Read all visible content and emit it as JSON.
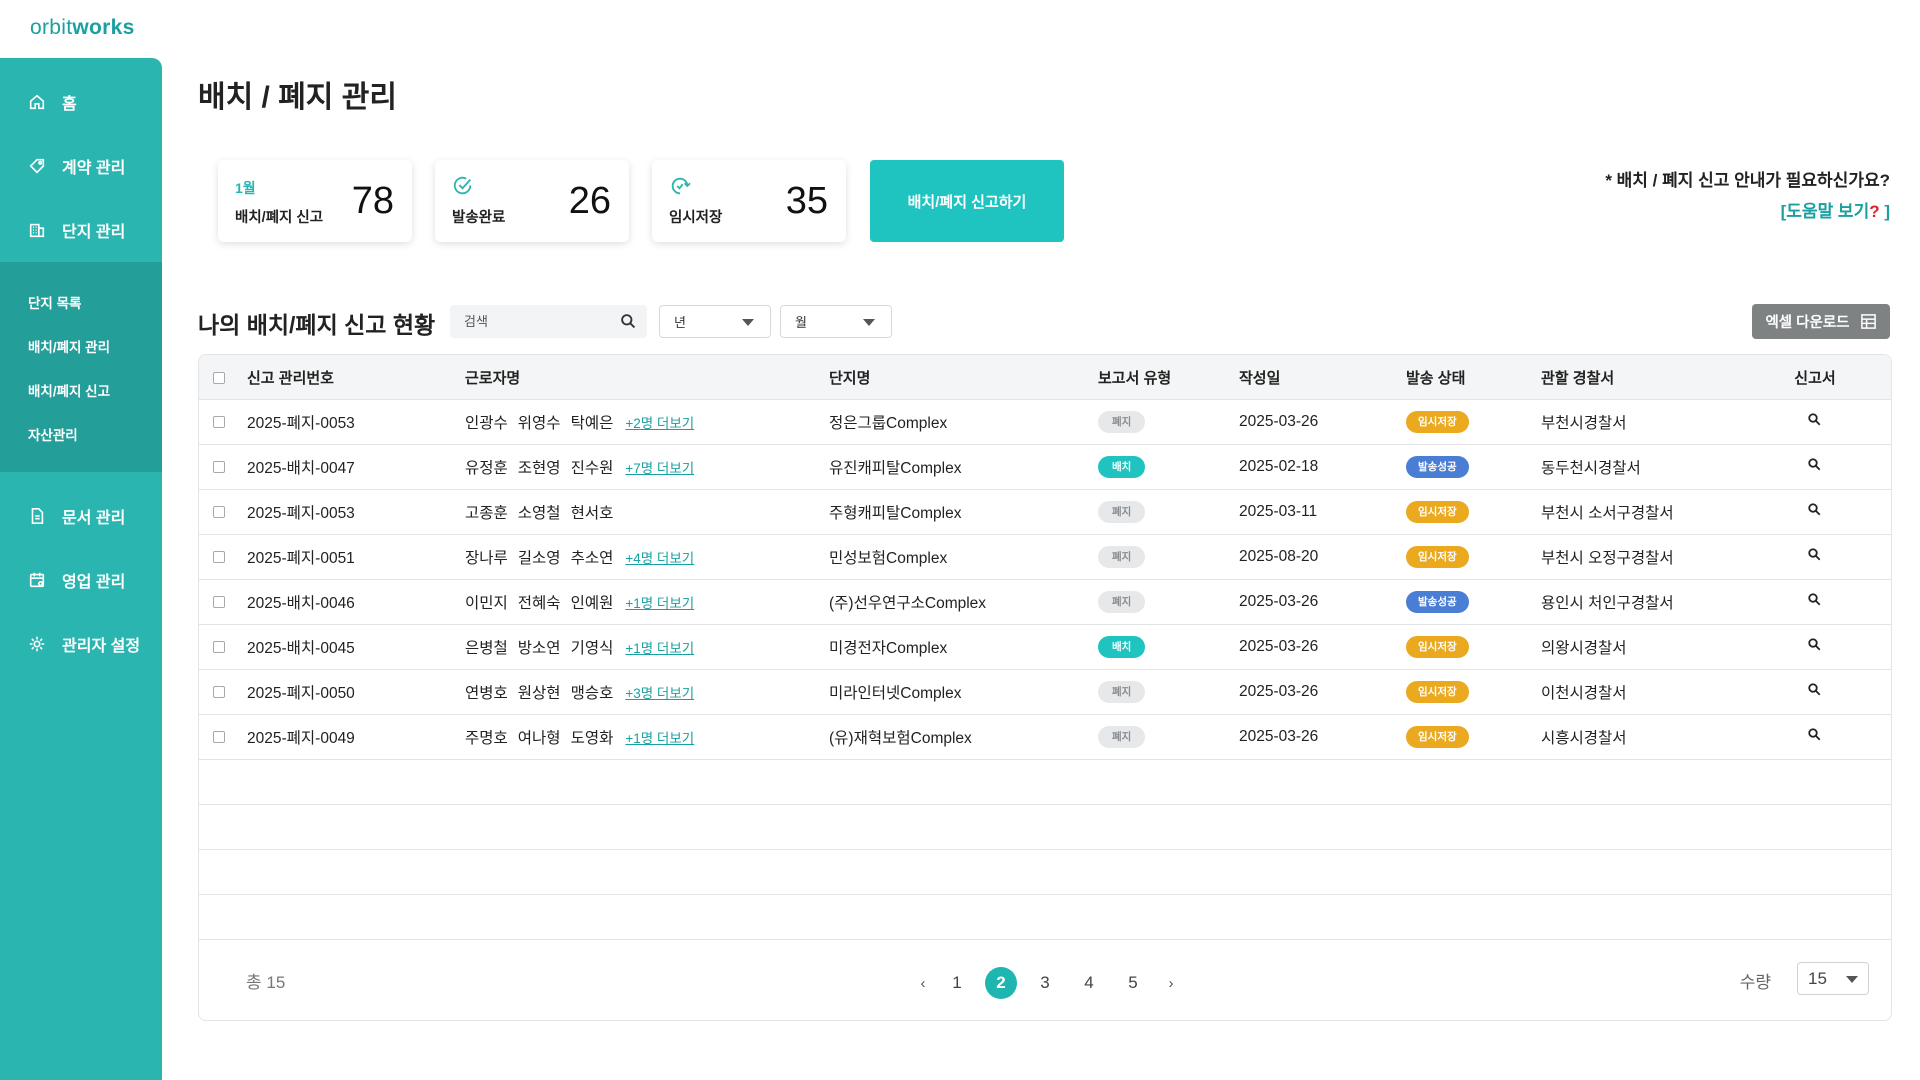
{
  "brand": {
    "prefix": "orbit",
    "suffix": "works"
  },
  "sidebar": {
    "items": [
      {
        "label": "홈",
        "icon": "home-icon"
      },
      {
        "label": "계약 관리",
        "icon": "tag-icon"
      },
      {
        "label": "단지 관리",
        "icon": "building-icon"
      }
    ],
    "sub_items": [
      {
        "label": "단지 목록"
      },
      {
        "label": "배치/폐지 관리"
      },
      {
        "label": "배치/폐지 신고"
      },
      {
        "label": "자산관리"
      }
    ],
    "items_bottom": [
      {
        "label": "문서 관리",
        "icon": "document-icon"
      },
      {
        "label": "영업 관리",
        "icon": "calendar-icon"
      },
      {
        "label": "관리자 설정",
        "icon": "gear-icon"
      }
    ]
  },
  "page": {
    "title": "배치 / 폐지 관리"
  },
  "stats": [
    {
      "top_label": "1월",
      "label": "배치/폐지 신고",
      "value": "78"
    },
    {
      "label": "발송완료",
      "value": "26",
      "icon": "check-circle-icon"
    },
    {
      "label": "임시저장",
      "value": "35",
      "icon": "save-icon"
    }
  ],
  "report_button": "배치/폐지 신고하기",
  "help": {
    "text": "* 배치 / 폐지 신고 안내가 필요하신가요?",
    "link_text": "[도움말 보기",
    "link_q": "?",
    "link_close": " ]"
  },
  "section": {
    "title": "나의 배치/폐지 신고 현황",
    "search_placeholder": "검색",
    "year_select": "년",
    "month_select": "월",
    "excel_button": "엑셀 다운로드"
  },
  "table": {
    "headers": [
      "신고 관리번호",
      "근로자명",
      "단지명",
      "보고서 유형",
      "작성일",
      "발송 상태",
      "관할 경찰서",
      "신고서"
    ],
    "rows": [
      {
        "id": "2025-폐지-0053",
        "names": [
          "인광수",
          "위영수",
          "탁예은"
        ],
        "more": "+2명 더보기",
        "complex": "정은그룹Complex",
        "type": "폐지",
        "date": "2025-03-26",
        "status": "임시저장",
        "police": "부천시경찰서"
      },
      {
        "id": "2025-배치-0047",
        "names": [
          "유정훈",
          "조현영",
          "진수원"
        ],
        "more": "+7명 더보기",
        "complex": "유진캐피탈Complex",
        "type": "배치",
        "date": "2025-02-18",
        "status": "발송성공",
        "police": "동두천시경찰서"
      },
      {
        "id": "2025-폐지-0053",
        "names": [
          "고종훈",
          "소영철",
          "현서호"
        ],
        "more": "",
        "complex": "주형캐피탈Complex",
        "type": "폐지",
        "date": "2025-03-11",
        "status": "임시저장",
        "police": "부천시 소서구경찰서"
      },
      {
        "id": "2025-폐지-0051",
        "names": [
          "장나루",
          "길소영",
          "추소연"
        ],
        "more": "+4명 더보기",
        "complex": "민성보험Complex",
        "type": "폐지",
        "date": "2025-08-20",
        "status": "임시저장",
        "police": "부천시 오정구경찰서"
      },
      {
        "id": "2025-배치-0046",
        "names": [
          "이민지",
          "전혜숙",
          "인예원"
        ],
        "more": "+1명 더보기",
        "complex": "(주)선우연구소Complex",
        "type": "폐지",
        "date": "2025-03-26",
        "status": "발송성공",
        "police": "용인시 처인구경찰서"
      },
      {
        "id": "2025-배치-0045",
        "names": [
          "은병철",
          "방소연",
          "기영식"
        ],
        "more": "+1명 더보기",
        "complex": "미경전자Complex",
        "type": "배치",
        "date": "2025-03-26",
        "status": "임시저장",
        "police": "의왕시경찰서"
      },
      {
        "id": "2025-폐지-0050",
        "names": [
          "연병호",
          "원상현",
          "맹승호"
        ],
        "more": "+3명 더보기",
        "complex": "미라인터넷Complex",
        "type": "폐지",
        "date": "2025-03-26",
        "status": "임시저장",
        "police": "이천시경찰서"
      },
      {
        "id": "2025-폐지-0049",
        "names": [
          "주명호",
          "여나형",
          "도영화"
        ],
        "more": "+1명 더보기",
        "complex": "(유)재혁보험Complex",
        "type": "폐지",
        "date": "2025-03-26",
        "status": "임시저장",
        "police": "시흥시경찰서"
      }
    ],
    "empty_rows": 4
  },
  "footer": {
    "total": "총 15",
    "pages": [
      "1",
      "2",
      "3",
      "4",
      "5"
    ],
    "current_page": "2",
    "prev": "‹",
    "next": "›",
    "qty_label": "수량",
    "qty_value": "15"
  },
  "colors": {
    "brand_teal": "#2ab5b0",
    "button_teal": "#1fc4c1",
    "status_saved": "#eba91f",
    "status_sent": "#4a7dd4",
    "type_disposal": "#e6e8ea",
    "type_deploy": "#1fc4c1"
  }
}
